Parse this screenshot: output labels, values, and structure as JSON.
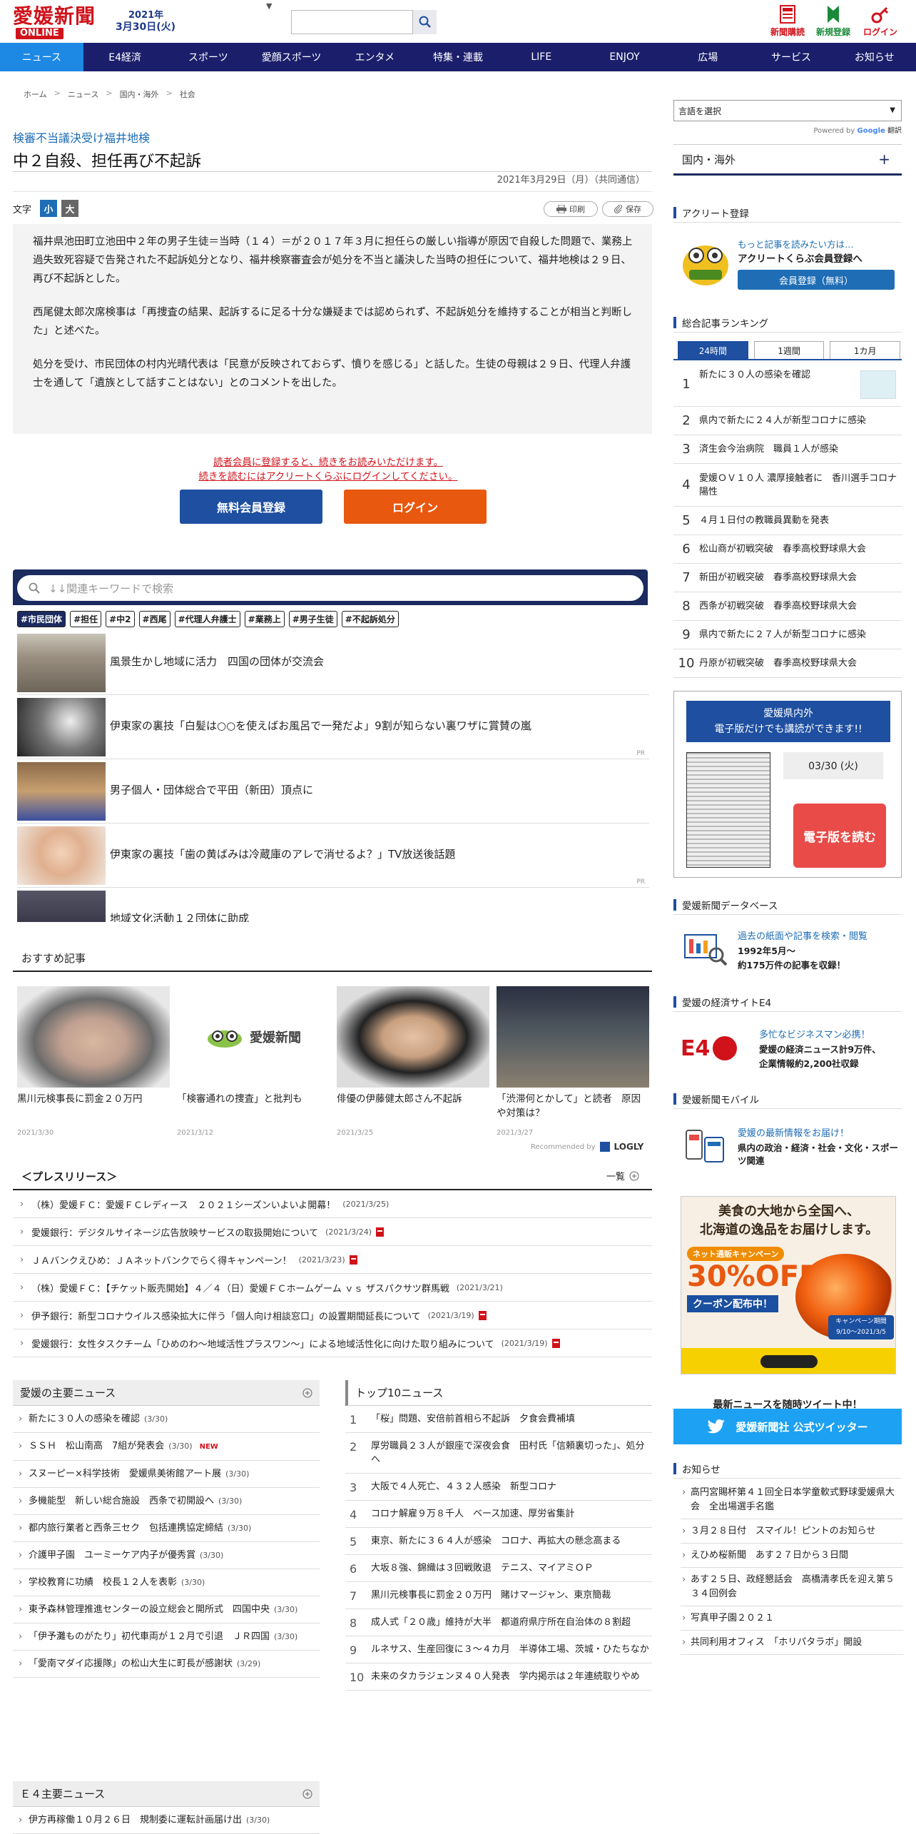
{
  "header": {
    "logo_main": "愛媛新聞",
    "logo_sub": "ONLINE",
    "date_year": "2021年",
    "date_day": "3月30日(火)",
    "icons": [
      {
        "label": "新聞購読",
        "color": "#d0121b",
        "icon": "newspaper-icon"
      },
      {
        "label": "新規登録",
        "color": "#1a8a3a",
        "icon": "bookmark-icon"
      },
      {
        "label": "ログイン",
        "color": "#d0121b",
        "icon": "key-icon"
      }
    ]
  },
  "nav": [
    "ニュース",
    "E4経済",
    "スポーツ",
    "愛顔スポーツ",
    "エンタメ",
    "特集・連載",
    "LIFE",
    "ENJOY",
    "広場",
    "サービス",
    "お知らせ"
  ],
  "breadcrumb": [
    "ホーム",
    "ニュース",
    "国内・海外",
    "社会"
  ],
  "article": {
    "subtitle": "検審不当議決受け福井地検",
    "title": "中２自殺、担任再び不起訴",
    "date": "2021年3月29日（月）（共同通信）",
    "font_label": "文字",
    "font_small": "小",
    "font_large": "大",
    "print_label": "印刷",
    "save_label": "保存",
    "paragraphs": [
      "福井県池田町立池田中２年の男子生徒＝当時（１４）＝が２０１７年３月に担任らの厳しい指導が原因で自殺した問題で、業務上過失致死容疑で告発された不起訴処分となり、福井検察審査会が処分を不当と議決した当時の担任について、福井地検は２９日、再び不起訴とした。",
      "西尾健太郎次席検事は「再捜査の結果、起訴するに足る十分な嫌疑までは認められず、不起訴処分を維持することが相当と判断した」と述べた。",
      "処分を受け、市民団体の村内光晴代表は「民意が反映されておらず、憤りを感じる」と話した。生徒の母親は２９日、代理人弁護士を通して「遺族として話すことはない」とのコメントを出した。"
    ],
    "register_note_1": "読者会員に登録すると、続きをお読みいただけます。",
    "register_note_2": "続きを読むにはアクリートくらぶにログインしてください。",
    "register_button": "無料会員登録",
    "login_button": "ログイン"
  },
  "keyword": {
    "placeholder": "↓↓関連キーワードで検索",
    "tags": [
      "#市民団体",
      "#担任",
      "#中2",
      "#西尾",
      "#代理人弁護士",
      "#業務上",
      "#男子生徒",
      "#不起訴処分"
    ],
    "items": [
      {
        "text": "風景生かし地域に活力　四国の団体が交流会",
        "pr": ""
      },
      {
        "text": "伊東家の裏技「白髪は○○を使えばお風呂で一発だよ」9割が知らない裏ワザに賞賛の嵐",
        "pr": "PR"
      },
      {
        "text": "男子個人・団体総合で平田（新田）頂点に",
        "pr": ""
      },
      {
        "text": "伊東家の裏技「歯の黄ばみは冷蔵庫のアレで消せるよ？」TV放送後話題",
        "pr": "PR"
      },
      {
        "text": "地域文化活動１２団体に助成",
        "pr": ""
      }
    ]
  },
  "osusume": {
    "title": "おすすめ記事",
    "cards": [
      {
        "text": "黒川元検事長に罰金２０万円",
        "date": "2021/3/30"
      },
      {
        "text": "「検審通れの捜査」と批判も",
        "date": "2021/3/12"
      },
      {
        "text": "俳優の伊藤健太郎さん不起訴",
        "date": "2021/3/25"
      },
      {
        "text": "「渋滞何とかして」と読者　原因や対策は？",
        "date": "2021/3/27"
      }
    ],
    "logo_text": "愛媛新聞",
    "recommended": "Recommended by",
    "logly": "LOGLY"
  },
  "press": {
    "title": "＜プレスリリース＞",
    "more": "一覧",
    "items": [
      {
        "text": "（株）愛媛ＦＣ：愛媛ＦＣレディース　２０２１シーズンいよいよ開幕！",
        "date": "(2021/3/25)",
        "pdf": false
      },
      {
        "text": "愛媛銀行：デジタルサイネージ広告放映サービスの取扱開始について",
        "date": "(2021/3/24)",
        "pdf": true
      },
      {
        "text": "ＪＡバンクえひめ：ＪＡネットバンクでらく得キャンペーン！",
        "date": "(2021/3/23)",
        "pdf": true
      },
      {
        "text": "（株）愛媛ＦＣ：【チケット販売開始】４／４（日）愛媛ＦＣホームゲーム ｖｓ ザスパクサツ群馬戦",
        "date": "(2021/3/21)",
        "pdf": false
      },
      {
        "text": "伊予銀行：新型コロナウイルス感染拡大に伴う「個人向け相談窓口」の設置期間延長について",
        "date": "(2021/3/19)",
        "pdf": true
      },
      {
        "text": "愛媛銀行：女性タスクチーム「ひめのわ～地域活性プラスワン～」による地域活性化に向けた取り組みについて",
        "date": "(2021/3/19)",
        "pdf": true
      }
    ]
  },
  "main_news": {
    "title": "愛媛の主要ニュース",
    "items": [
      {
        "text": "新たに３０人の感染を確認",
        "date": "(3/30)",
        "new": ""
      },
      {
        "text": "ＳＳＨ　松山南高　7組が発表会",
        "date": "(3/30)",
        "new": "NEW"
      },
      {
        "text": "スヌーピー×科学技術　愛媛県美術館アート展",
        "date": "(3/30)",
        "new": ""
      },
      {
        "text": "多機能型　新しい総合施設　西条で初開設へ",
        "date": "(3/30)",
        "new": ""
      },
      {
        "text": "都内旅行業者と西条三セク　包括連携協定締結",
        "date": "(3/30)",
        "new": ""
      },
      {
        "text": "介護甲子園　ユーミーケア内子が優秀賞",
        "date": "(3/30)",
        "new": ""
      },
      {
        "text": "学校教育に功績　校長１２人を表彰",
        "date": "(3/30)",
        "new": ""
      },
      {
        "text": "東予森林管理推進センターの設立総会と開所式　四国中央",
        "date": "(3/30)",
        "new": ""
      },
      {
        "text": "「伊予灘ものがたり」初代車両が１２月で引退　ＪＲ四国",
        "date": "(3/30)",
        "new": ""
      },
      {
        "text": "「愛南マダイ応援隊」の松山大生に町長が感謝状",
        "date": "(3/29)",
        "new": ""
      }
    ]
  },
  "top10": {
    "title": "トップ10ニュース",
    "items": [
      "「桜」問題、安倍前首相ら不起訴　夕食会費補填",
      "厚労職員２３人が銀座で深夜会食　田村氏「信頼裏切った」、処分へ",
      "大阪で４人死亡、４３２人感染　新型コロナ",
      "コロナ解雇９万８千人　ベース加速、厚労省集計",
      "東京、新たに３６４人が感染　コロナ、再拡大の懸念高まる",
      "大坂８強、錦織は３回戦敗退　テニス、マイアミＯＰ",
      "黒川元検事長に罰金２０万円　賭けマージャン、東京簡裁",
      "成人式「２０歳」維持が大半　都道府県庁所在自治体の８割超",
      "ルネサス、生産回復に３～４カ月　半導体工場、茨城・ひたちなか",
      "未来のタカラジェンヌ４０人発表　学内掲示は２年連続取りやめ"
    ]
  },
  "e4news": {
    "title": "Ｅ４主要ニュース",
    "items": [
      {
        "text": "伊方再稼働１０月２６日　規制委に運転計画届け出",
        "date": "(3/30)"
      }
    ]
  },
  "sidebar": {
    "lang": "言語を選択",
    "powered": "Powered by",
    "google": "Google",
    "translate": "翻訳",
    "kokunai": "国内・海外",
    "acrete_head": "アクリート登録",
    "acrete_line1": "もっと記事を読みたい方は…",
    "acrete_line2": "アクリートくらぶ会員登録へ",
    "acrete_btn": "会員登録（無料）",
    "ranking_head": "総合記事ランキング",
    "tabs": [
      "24時間",
      "1週間",
      "1カ月"
    ],
    "ranking": [
      "新たに３０人の感染を確認",
      "県内で新たに２４人が新型コロナに感染",
      "済生会今治病院　職員１人が感染",
      "愛媛ＯＶ１０人 濃厚接触者に　香川選手コロナ陽性",
      "４月１日付の教職員異動を発表",
      "松山商が初戦突破　春季高校野球県大会",
      "新田が初戦突破　春季高校野球県大会",
      "西条が初戦突破　春季高校野球県大会",
      "県内で新たに２７人が新型コロナに感染",
      "丹原が初戦突破　春季高校野球県大会"
    ],
    "epaper_head_1": "愛媛県内外",
    "epaper_head_2": "電子版だけでも講読ができます!!",
    "epaper_date": "03/30 (火)",
    "epaper_btn": "電子版を読む",
    "db_head": "愛媛新聞データベース",
    "db_line1": "過去の紙面や記事を検索・閲覧",
    "db_line2": "1992年5月～",
    "db_line3": "約175万件の記事を収録！",
    "e4_head": "愛媛の経済サイトE4",
    "e4_line1": "多忙なビジネスマン必携！",
    "e4_line2": "愛媛の経済ニュース計9万件、",
    "e4_line3": "企業情報約2,200社収録",
    "mobile_head": "愛媛新聞モバイル",
    "mobile_line1": "愛媛の最新情報をお届け！",
    "mobile_line2": "県内の政治・経済・社会・文化・スポーツ関連",
    "ad_line1": "美食の大地から全国へ、",
    "ad_line2": "北海道の逸品をお届けします。",
    "ad_badge": "ネット通販キャンペーン",
    "ad_off": "30%OFF",
    "ad_coupon": "クーポン配布中！",
    "ad_period": "キャンペーン期間",
    "ad_dates": "9/10～2021/3/5",
    "tw_note": "最新ニュースを随時ツイート中！",
    "tw_btn": "愛媛新聞社 公式ツイッター",
    "oshirase_head": "お知らせ",
    "oshirase": [
      "高円宮賜杯第４１回全日本学童軟式野球愛媛県大会　全出場選手名鑑",
      "３月２８日付　スマイル！ピントのお知らせ",
      "えひめ桜新聞　あす２７日から３日間",
      "あす２５日、政経懇話会　高橋清孝氏を迎え第５３４回例会",
      "写真甲子園２０２１",
      "共同利用オフィス　「ホリパタラボ」開設"
    ]
  }
}
